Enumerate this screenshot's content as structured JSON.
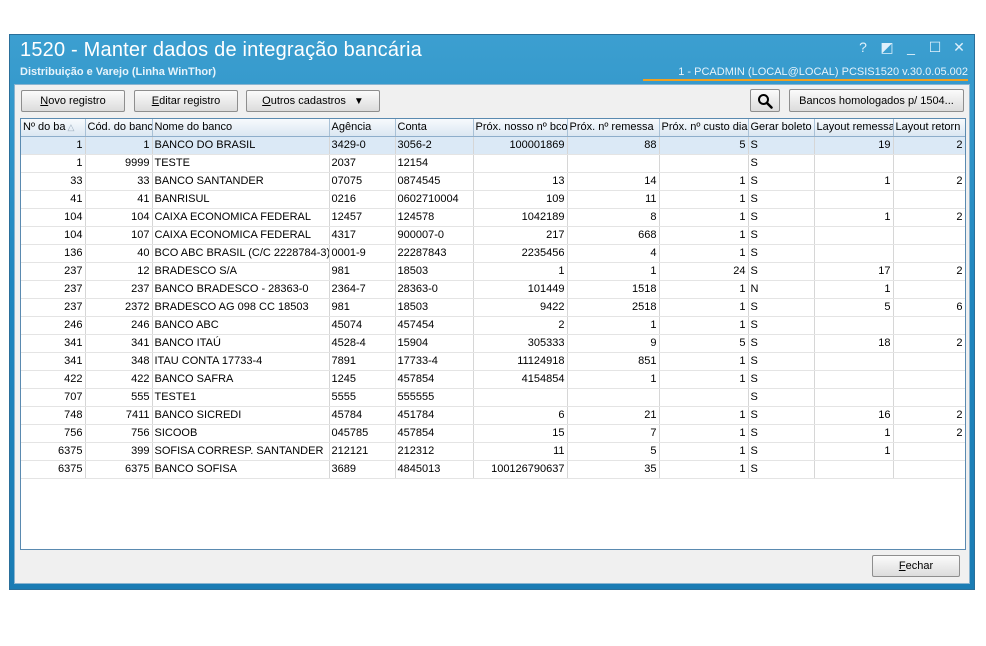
{
  "window": {
    "title": "1520 - Manter dados de integração bancária",
    "subtitle": "Distribuição e Varejo (Linha WinThor)",
    "status": "1 - PCADMIN (LOCAL@LOCAL)   PCSIS1520  v.30.0.05.002",
    "controls": {
      "help": "?",
      "restore": "◩",
      "minimize": "_",
      "maximize": "☐",
      "close": "✕"
    }
  },
  "toolbar": {
    "novo_acc": "N",
    "novo_rest": "ovo registro",
    "editar_acc": "E",
    "editar_rest": "ditar registro",
    "outros_acc": "O",
    "outros_rest": "utros cadastros",
    "outros_arrow": "▼",
    "search_glyph": "🔍",
    "homologados_label": "Bancos homologados p/ 1504..."
  },
  "grid": {
    "sort_indicator": "△",
    "columns": [
      "Nº do ba",
      "Cód. do banc",
      "Nome do banco",
      "Agência",
      "Conta",
      "Próx. nosso nº bco",
      "Próx. nº remessa",
      "Próx. nº custo dia",
      "Gerar boleto",
      "Layout remessa",
      "Layout retorn"
    ],
    "rows": [
      [
        "1",
        "1",
        "BANCO DO BRASIL",
        "3429-0",
        "3056-2",
        "100001869",
        "88",
        "5",
        "S",
        "19",
        "2"
      ],
      [
        "1",
        "9999",
        "TESTE",
        "2037",
        "12154",
        "",
        "",
        "",
        "S",
        "",
        ""
      ],
      [
        "33",
        "33",
        "BANCO SANTANDER",
        "07075",
        "0874545",
        "13",
        "14",
        "1",
        "S",
        "1",
        "2"
      ],
      [
        "41",
        "41",
        "BANRISUL",
        "0216",
        "0602710004",
        "109",
        "11",
        "1",
        "S",
        "",
        ""
      ],
      [
        "104",
        "104",
        "CAIXA ECONOMICA FEDERAL",
        "12457",
        "124578",
        "1042189",
        "8",
        "1",
        "S",
        "1",
        "2"
      ],
      [
        "104",
        "107",
        "CAIXA ECONOMICA FEDERAL",
        "4317",
        "900007-0",
        "217",
        "668",
        "1",
        "S",
        "",
        ""
      ],
      [
        "136",
        "40",
        "BCO ABC BRASIL (C/C 2228784-3)",
        "0001-9",
        "22287843",
        "2235456",
        "4",
        "1",
        "S",
        "",
        ""
      ],
      [
        "237",
        "12",
        "BRADESCO S/A",
        "981",
        "18503",
        "1",
        "1",
        "24",
        "S",
        "17",
        "2"
      ],
      [
        "237",
        "237",
        "BANCO BRADESCO - 28363-0",
        "2364-7",
        "28363-0",
        "101449",
        "1518",
        "1",
        "N",
        "1",
        ""
      ],
      [
        "237",
        "2372",
        "BRADESCO AG 098 CC 18503",
        "981",
        "18503",
        "9422",
        "2518",
        "1",
        "S",
        "5",
        "6"
      ],
      [
        "246",
        "246",
        "BANCO ABC",
        "45074",
        "457454",
        "2",
        "1",
        "1",
        "S",
        "",
        ""
      ],
      [
        "341",
        "341",
        "BANCO ITAÚ",
        "4528-4",
        "15904",
        "305333",
        "9",
        "5",
        "S",
        "18",
        "2"
      ],
      [
        "341",
        "348",
        "ITAU CONTA 17733-4",
        "7891",
        "17733-4",
        "11124918",
        "851",
        "1",
        "S",
        "",
        ""
      ],
      [
        "422",
        "422",
        "BANCO SAFRA",
        "1245",
        "457854",
        "4154854",
        "1",
        "1",
        "S",
        "",
        ""
      ],
      [
        "707",
        "555",
        "TESTE1",
        "5555",
        "555555",
        "",
        "",
        "",
        "S",
        "",
        ""
      ],
      [
        "748",
        "7411",
        "BANCO SICREDI",
        "45784",
        "451784",
        "6",
        "21",
        "1",
        "S",
        "16",
        "2"
      ],
      [
        "756",
        "756",
        "SICOOB",
        "045785",
        "457854",
        "15",
        "7",
        "1",
        "S",
        "1",
        "2"
      ],
      [
        "6375",
        "399",
        "SOFISA CORRESP. SANTANDER",
        "212121",
        "212312",
        "11",
        "5",
        "1",
        "S",
        "1",
        ""
      ],
      [
        "6375",
        "6375",
        "BANCO SOFISA",
        "3689",
        "4845013",
        "100126790637",
        "35",
        "1",
        "S",
        "",
        ""
      ]
    ]
  },
  "footer": {
    "fechar_acc": "F",
    "fechar_rest": "echar"
  }
}
